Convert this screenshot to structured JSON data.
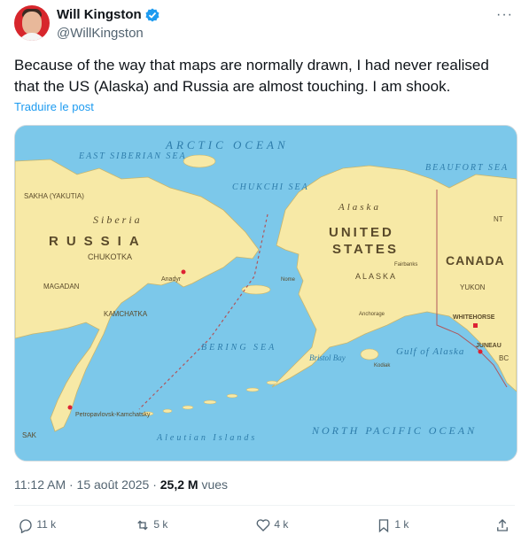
{
  "author": {
    "name": "Will Kingston",
    "handle": "@WillKingston"
  },
  "tweet": {
    "text": "Because of the way that maps are normally drawn, I had never realised that the US (Alaska) and Russia are almost touching. I am shook.",
    "translate_label": "Traduire le post"
  },
  "map_labels": {
    "arctic": "ARCTIC OCEAN",
    "east_siberian": "EAST SIBERIAN SEA",
    "chukchi": "CHUKCHI SEA",
    "beaufort": "BEAUFORT SEA",
    "sakha": "SAKHA (YAKUTIA)",
    "siberia": "Siberia",
    "russia": "RUSSIA",
    "chukotka": "CHUKOTKA",
    "magadan": "MAGADAN",
    "kamchatka": "KAMCHATKA",
    "anadyr": "Anadyr",
    "alaska_region": "Alaska",
    "united": "UNITED",
    "states": "STATES",
    "alaska": "ALASKA",
    "canada": "CANADA",
    "nt": "NT",
    "yukon": "YUKON",
    "whitehorse": "WHITEHORSE",
    "juneau": "JUNEAU",
    "bc": "BC",
    "bering": "BERING SEA",
    "gulf_alaska": "Gulf of Alaska",
    "north_pacific": "NORTH PACIFIC OCEAN",
    "aleutian": "Aleutian Islands",
    "petropavlovsk": "Petropavlovsk-Kamchatsky",
    "sak": "SAK",
    "bristol": "Bristol Bay",
    "kodiak": "Kodiak",
    "fairbanks": "Fairbanks",
    "anchorage": "Anchorage",
    "nome": "Nome"
  },
  "meta": {
    "time": "11:12 AM · 15 août 2025 · ",
    "views": "25,2 M",
    "views_label": " vues"
  },
  "actions": {
    "replies": "11 k",
    "reposts": "5 k",
    "likes": "4 k",
    "bookmarks": "1 k"
  },
  "colors": {
    "sea": "#7cc8ea",
    "land": "#f7e9a6",
    "link": "#1d9bf0",
    "verified": "#1d9bf0"
  }
}
